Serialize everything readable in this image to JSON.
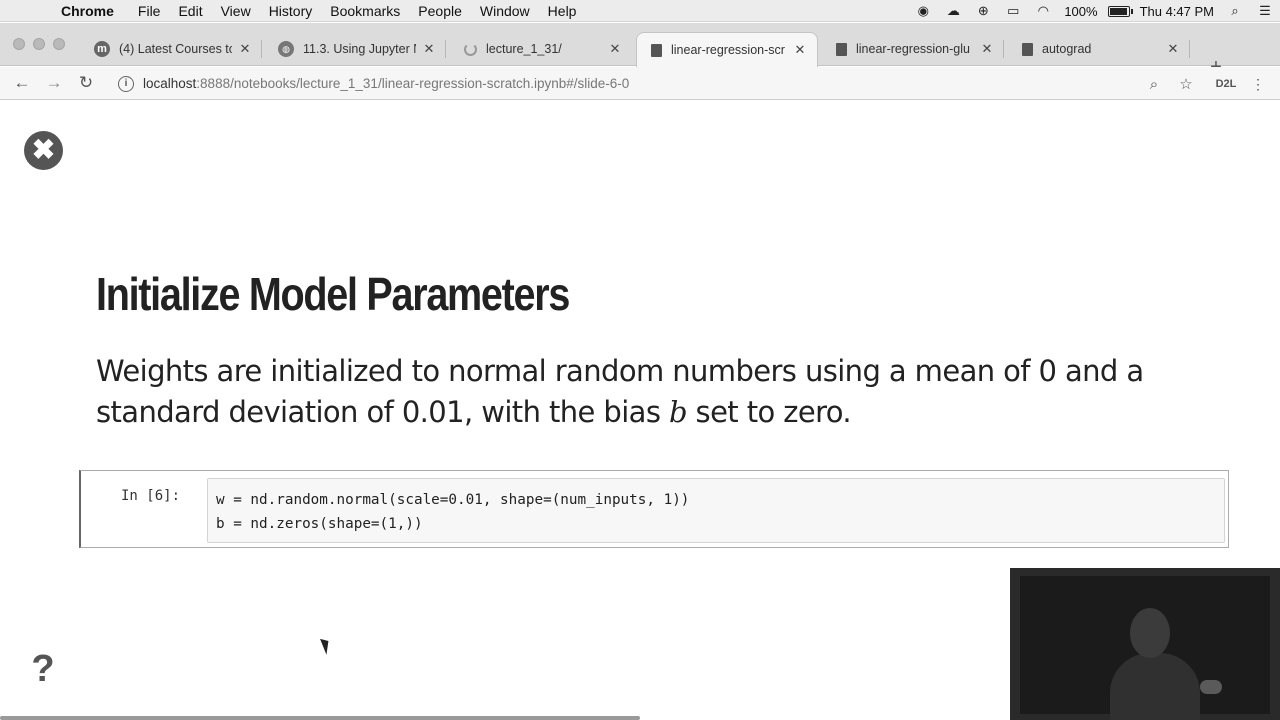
{
  "menubar": {
    "items": [
      "Chrome",
      "File",
      "Edit",
      "View",
      "History",
      "Bookmarks",
      "People",
      "Window",
      "Help"
    ],
    "battery_text": "100%",
    "battery_level": 1.0,
    "clock": "Thu 4:47 PM"
  },
  "tabs": [
    {
      "title": "(4) Latest Courses to",
      "favicon": "m-circle-icon"
    },
    {
      "title": "11.3. Using Jupyter N",
      "favicon": "globe-icon"
    },
    {
      "title": "lecture_1_31/",
      "favicon": "loading-spinner-icon"
    },
    {
      "title": "linear-regression-scr",
      "favicon": "document-icon",
      "active": true
    },
    {
      "title": "linear-regression-glu",
      "favicon": "document-icon"
    },
    {
      "title": "autograd",
      "favicon": "document-icon"
    }
  ],
  "toolbar": {
    "url_host": "localhost",
    "url_rest": ":8888/notebooks/lecture_1_31/linear-regression-scratch.ipynb#/slide-6-0",
    "extension_label": "D2L"
  },
  "slide": {
    "title": "Initialize Model Parameters",
    "text_before_math": "Weights are initialized to normal random numbers using a mean of 0 and a standard deviation of 0.01, with the bias ",
    "math_symbol": "b",
    "text_after_math": " set to zero."
  },
  "cell": {
    "prompt": "In [6]:",
    "lines": [
      "w = nd.random.normal(scale=0.01, shape=(num_inputs, 1))",
      "b = nd.zeros(shape=(1,))"
    ]
  },
  "help_label": "?",
  "close_label": "✖"
}
